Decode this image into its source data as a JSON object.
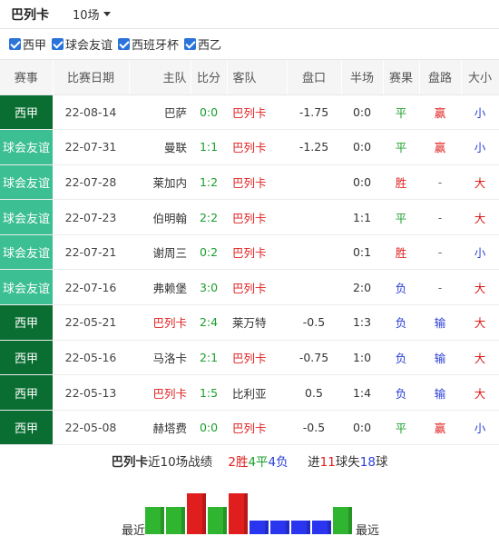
{
  "header": {
    "team": "巴列卡",
    "match_count": "10场"
  },
  "filters": [
    {
      "label": "西甲",
      "checked": true
    },
    {
      "label": "球会友谊",
      "checked": true
    },
    {
      "label": "西班牙杯",
      "checked": true
    },
    {
      "label": "西乙",
      "checked": true
    }
  ],
  "table": {
    "headers": [
      "赛事",
      "比赛日期",
      "主队",
      "比分",
      "客队",
      "盘口",
      "半场",
      "赛果",
      "盘路",
      "大小"
    ],
    "rows": [
      {
        "league": "西甲",
        "date": "22-08-14",
        "home": "巴萨",
        "score": "0:0",
        "away": "巴列卡",
        "handicap": "-1.75",
        "halftime": "0:0",
        "result": "平",
        "cover": "赢",
        "ou": "小"
      },
      {
        "league": "球会友谊",
        "date": "22-07-31",
        "home": "曼联",
        "score": "1:1",
        "away": "巴列卡",
        "handicap": "-1.25",
        "halftime": "0:0",
        "result": "平",
        "cover": "赢",
        "ou": "小"
      },
      {
        "league": "球会友谊",
        "date": "22-07-28",
        "home": "莱加内",
        "score": "1:2",
        "away": "巴列卡",
        "handicap": "",
        "halftime": "0:0",
        "result": "胜",
        "cover": "-",
        "ou": "大"
      },
      {
        "league": "球会友谊",
        "date": "22-07-23",
        "home": "伯明翰",
        "score": "2:2",
        "away": "巴列卡",
        "handicap": "",
        "halftime": "1:1",
        "result": "平",
        "cover": "-",
        "ou": "大"
      },
      {
        "league": "球会友谊",
        "date": "22-07-21",
        "home": "谢周三",
        "score": "0:2",
        "away": "巴列卡",
        "handicap": "",
        "halftime": "0:1",
        "result": "胜",
        "cover": "-",
        "ou": "小"
      },
      {
        "league": "球会友谊",
        "date": "22-07-16",
        "home": "弗赖堡",
        "score": "3:0",
        "away": "巴列卡",
        "handicap": "",
        "halftime": "2:0",
        "result": "负",
        "cover": "-",
        "ou": "大"
      },
      {
        "league": "西甲",
        "date": "22-05-21",
        "home": "巴列卡",
        "score": "2:4",
        "away": "莱万特",
        "handicap": "-0.5",
        "halftime": "1:3",
        "result": "负",
        "cover": "输",
        "ou": "大"
      },
      {
        "league": "西甲",
        "date": "22-05-16",
        "home": "马洛卡",
        "score": "2:1",
        "away": "巴列卡",
        "handicap": "-0.75",
        "halftime": "1:0",
        "result": "负",
        "cover": "输",
        "ou": "大"
      },
      {
        "league": "西甲",
        "date": "22-05-13",
        "home": "巴列卡",
        "score": "1:5",
        "away": "比利亚",
        "handicap": "0.5",
        "halftime": "1:4",
        "result": "负",
        "cover": "输",
        "ou": "大"
      },
      {
        "league": "西甲",
        "date": "22-05-08",
        "home": "赫塔费",
        "score": "0:0",
        "away": "巴列卡",
        "handicap": "-0.5",
        "halftime": "0:0",
        "result": "平",
        "cover": "赢",
        "ou": "小"
      }
    ]
  },
  "summary": {
    "team": "巴列卡",
    "prefix": "近10场战绩",
    "wins": "2胜",
    "draws": "4平",
    "losses": "4负",
    "goals_prefix": "进",
    "goals_for": "11",
    "goals_mid": "球失",
    "goals_against": "18",
    "goals_suffix": "球"
  },
  "form_chart": {
    "label_recent": "最近",
    "label_old": "最远",
    "results": [
      "平",
      "平",
      "胜",
      "平",
      "胜",
      "负",
      "负",
      "负",
      "负",
      "平"
    ],
    "colors": {
      "win": "#e01e1e",
      "draw": "#2fb52f",
      "loss": "#2a35f0"
    },
    "levels": {
      "win": 3,
      "draw": 2,
      "loss": 1
    }
  }
}
